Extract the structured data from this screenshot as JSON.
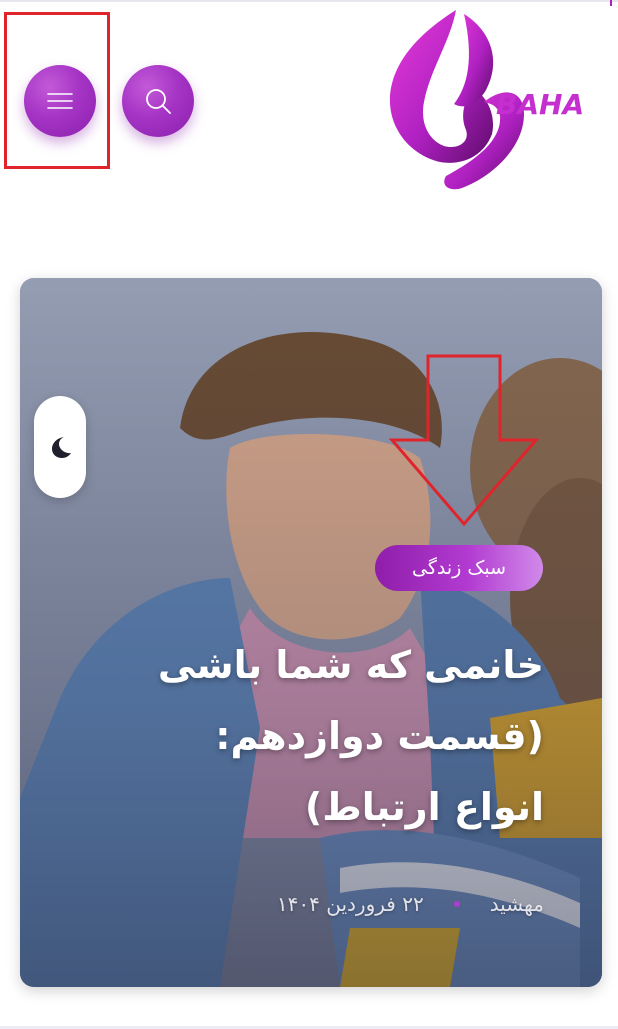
{
  "header": {
    "menu_button_icon": "hamburger-menu-icon",
    "search_button_icon": "search-icon",
    "logo_text": "BAHA",
    "accent_color": "#a534c4"
  },
  "featured_post": {
    "category": "سبک زندگی",
    "title_lines": [
      "خانمی که شما باشی",
      "(قسمت دوازدهم:",
      "انواع ارتباط)"
    ],
    "author": "مهشید",
    "date": "۲۲ فروردین ۱۴۰۴"
  },
  "night_mode_toggle": {
    "icon": "crescent-moon-icon"
  }
}
